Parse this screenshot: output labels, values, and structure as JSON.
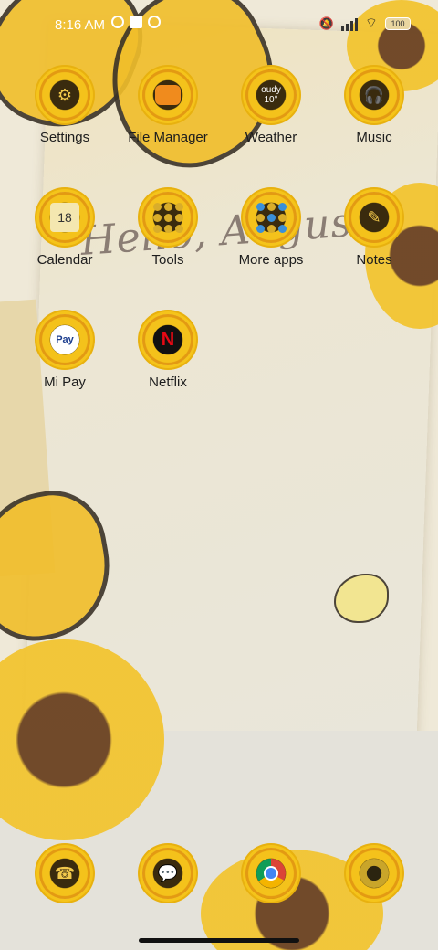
{
  "status_bar": {
    "time": "8:16 AM",
    "battery": "100"
  },
  "wallpaper": {
    "greeting": "Hello, August"
  },
  "apps": [
    {
      "label": "Settings",
      "icon": "gear-icon"
    },
    {
      "label": "File Manager",
      "icon": "folder-icon"
    },
    {
      "label": "Weather",
      "icon": "cloud-icon",
      "widget_text": "oudy 10°"
    },
    {
      "label": "Music",
      "icon": "headphones-icon"
    },
    {
      "label": "Calendar",
      "icon": "calendar-icon",
      "widget_text": "18"
    },
    {
      "label": "Tools",
      "icon": "folder-grid-icon"
    },
    {
      "label": "More apps",
      "icon": "folder-grid-icon"
    },
    {
      "label": "Notes",
      "icon": "pencil-icon"
    },
    {
      "label": "Mi Pay",
      "icon": "mi-pay-icon",
      "widget_text": "Pay"
    },
    {
      "label": "Netflix",
      "icon": "netflix-icon",
      "widget_text": "N"
    }
  ],
  "dock": [
    {
      "icon": "phone-icon"
    },
    {
      "icon": "messages-icon"
    },
    {
      "icon": "chrome-icon"
    },
    {
      "icon": "camera-icon"
    }
  ],
  "colors": {
    "badge_yellow": "#f4c21b",
    "badge_center": "#3a2b0e",
    "label_text": "#1d1d1d"
  }
}
